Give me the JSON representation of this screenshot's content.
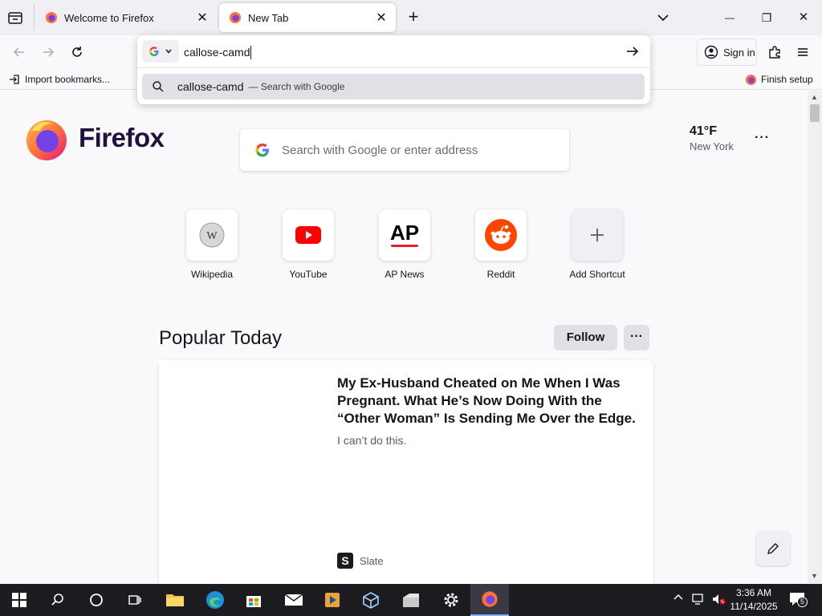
{
  "tabs": [
    {
      "label": "Welcome to Firefox",
      "active": false
    },
    {
      "label": "New Tab",
      "active": true
    }
  ],
  "new_tab_symbol": "+",
  "window_controls": {
    "minimize": "—",
    "restore": "❐",
    "close": "✕"
  },
  "urlbar": {
    "value": "callose-camd",
    "engine_icon": "google-icon",
    "suggestion_text": "callose-camd",
    "suggestion_action": "— Search with Google"
  },
  "toolbar": {
    "sign_in_label": "Sign in"
  },
  "bookmarks_bar": {
    "import_label": "Import bookmarks...",
    "finish_setup_label": "Finish setup"
  },
  "newtab": {
    "brand": "Firefox",
    "search_placeholder": "Search with Google or enter address",
    "weather": {
      "temp": "41°F",
      "city": "New York"
    },
    "shortcuts": [
      {
        "label": "Wikipedia",
        "icon": "wikipedia-icon"
      },
      {
        "label": "YouTube",
        "icon": "youtube-icon"
      },
      {
        "label": "AP News",
        "icon": "ap-news-icon"
      },
      {
        "label": "Reddit",
        "icon": "reddit-icon"
      },
      {
        "label": "Add Shortcut",
        "icon": "plus-icon"
      }
    ],
    "popular_heading": "Popular Today",
    "follow_label": "Follow",
    "story": {
      "title": "My Ex-Husband Cheated on Me When I Was Pregnant. What He’s Now Doing With the “Other Woman” Is Sending Me Over the Edge.",
      "excerpt": "I can’t do this.",
      "source": "Slate"
    }
  },
  "taskbar": {
    "time": "3:36 AM",
    "date": "11/14/2025",
    "notification_count": "5"
  },
  "colors": {
    "accent": "#0061e0",
    "firefox_orange": "#ff7139",
    "youtube_red": "#ff0000",
    "reddit_orange": "#ff4500",
    "ap_red": "#e4202e"
  }
}
